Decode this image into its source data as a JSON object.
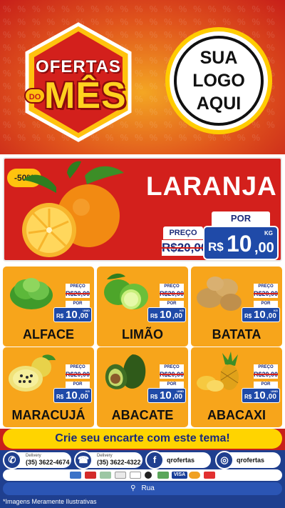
{
  "header": {
    "badge_ofertas": "OFERTAS",
    "badge_do": "DO",
    "badge_mes": "MÊS",
    "logo_lines": [
      "SUA",
      "LOGO",
      "AQUI"
    ]
  },
  "feature": {
    "discount": "-50%",
    "title": "LARANJA",
    "price_label": "PREÇO",
    "old_price": "R$20,00",
    "por_label": "POR",
    "currency": "R$",
    "price_int": "10",
    "price_cents": ",00",
    "unit": "KG",
    "icon": "orange-fruit-icon"
  },
  "products": [
    {
      "name": "ALFACE",
      "price_label": "PREÇO",
      "old_price": "R$20,00",
      "por_label": "POR",
      "currency": "R$",
      "price_int": "10",
      "price_cents": ",00",
      "unit": "UNID",
      "icon": "lettuce-icon"
    },
    {
      "name": "LIMÃO",
      "price_label": "PREÇO",
      "old_price": "R$20,00",
      "por_label": "POR",
      "currency": "R$",
      "price_int": "10",
      "price_cents": ",00",
      "unit": "KG",
      "icon": "lime-icon"
    },
    {
      "name": "BATATA",
      "price_label": "PREÇO",
      "old_price": "R$20,00",
      "por_label": "POR",
      "currency": "R$",
      "price_int": "10",
      "price_cents": ",00",
      "unit": "KG",
      "icon": "potato-icon"
    },
    {
      "name": "MARACUJÁ",
      "price_label": "PREÇO",
      "old_price": "R$20,00",
      "por_label": "POR",
      "currency": "R$",
      "price_int": "10",
      "price_cents": ",00",
      "unit": "KG",
      "icon": "passion-fruit-icon"
    },
    {
      "name": "ABACATE",
      "price_label": "PREÇO",
      "old_price": "R$20,00",
      "por_label": "POR",
      "currency": "R$",
      "price_int": "10",
      "price_cents": ",00",
      "unit": "UNID",
      "icon": "avocado-icon"
    },
    {
      "name": "ABACAXI",
      "price_label": "PREÇO",
      "old_price": "R$20,00",
      "por_label": "POR",
      "currency": "R$",
      "price_int": "10",
      "price_cents": ",00",
      "unit": "UNID",
      "icon": "pineapple-icon"
    }
  ],
  "cta": "Crie seu encarte com este tema!",
  "contacts": {
    "whatsapp_small": "Delivery",
    "whatsapp_number": "(35) 3622-4674",
    "phone_small": "Delivery",
    "phone_number": "(35) 3622-4322",
    "facebook": "qrofertas",
    "instagram": "qrofertas"
  },
  "payments": [
    "VISA"
  ],
  "street": "Rua",
  "disclaimer": "*Imagens Meramente Ilustrativas",
  "colors": {
    "brand_red": "#d3201c",
    "accent_yellow": "#ffd400",
    "card_orange": "#f7a51b",
    "price_blue": "#1f4aa8",
    "footer_blue": "#1f3f8f"
  }
}
